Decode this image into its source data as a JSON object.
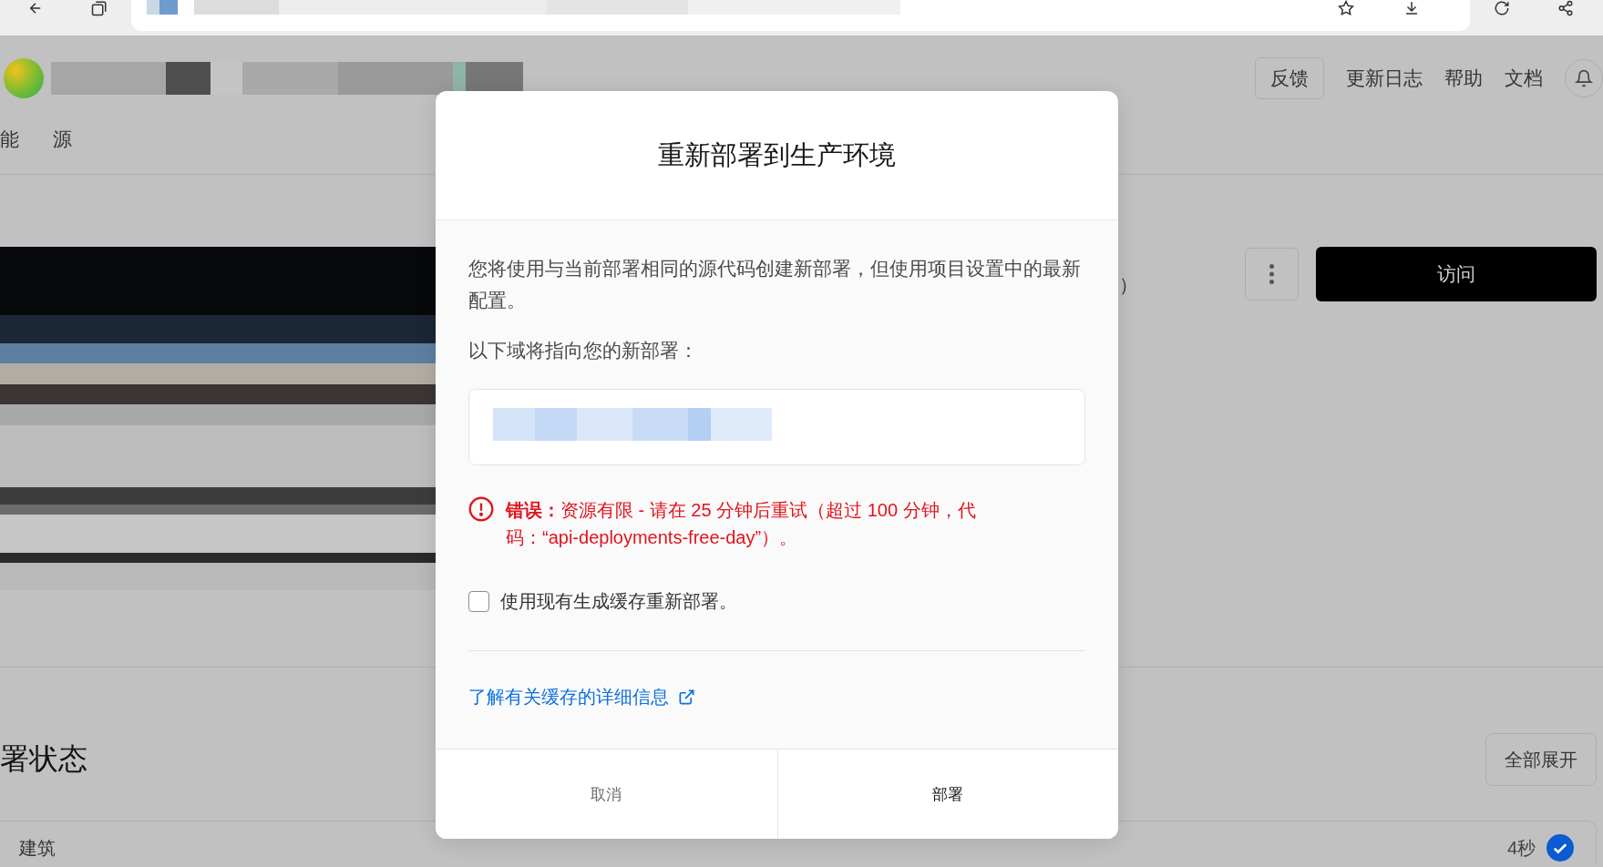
{
  "header": {
    "actions": [
      {
        "label": "反馈",
        "kind": "button"
      },
      {
        "label": "更新日志",
        "kind": "link"
      },
      {
        "label": "帮助",
        "kind": "link"
      },
      {
        "label": "文档",
        "kind": "link"
      }
    ]
  },
  "nav": {
    "tabs": [
      {
        "label": "能"
      },
      {
        "label": "源"
      }
    ]
  },
  "deployment": {
    "fragment": "）",
    "visit_button": "访问"
  },
  "status": {
    "heading": "署状态",
    "expand_button": "全部展开",
    "rows": [
      {
        "label": "建筑",
        "duration": "4秒",
        "done": true
      }
    ]
  },
  "dialog": {
    "title": "重新部署到生产环境",
    "description": "您将使用与当前部署相同的源代码创建新部署，但使用项目设置中的最新配置。",
    "domains_label": "以下域将指向您的新部署：",
    "error": "**错误：**资源有限 - 请在 25 分钟后重试（超过 100 分钟，代码：“api-deployments-free-day”）。",
    "use_build_cache": {
      "label": "使用现有生成缓存重新部署。",
      "checked": false
    },
    "learn_more_link": "了解有关缓存的详细信息",
    "buttons": [
      {
        "label": "取消",
        "kind": "secondary"
      },
      {
        "label": "部署",
        "kind": "primary"
      }
    ]
  }
}
